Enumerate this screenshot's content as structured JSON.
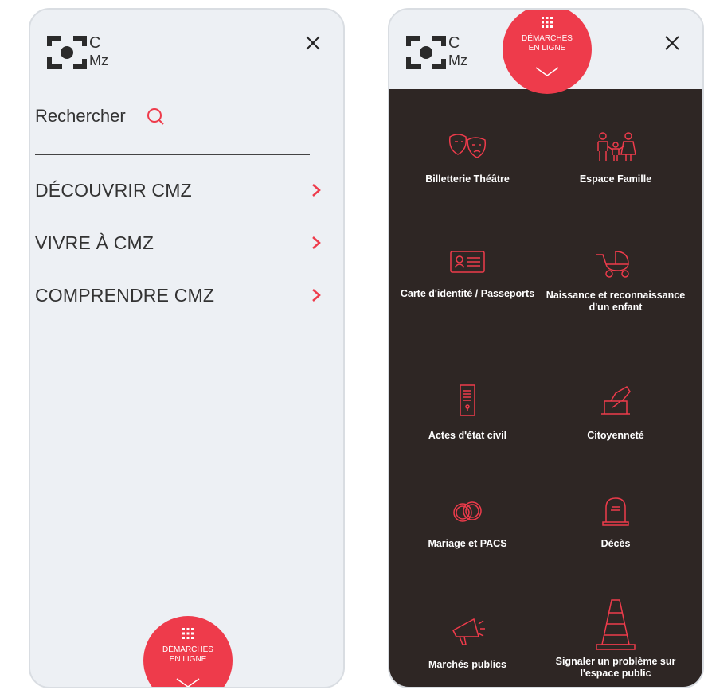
{
  "logo": {
    "letters": [
      "C",
      "Mz"
    ]
  },
  "left_panel": {
    "search_label": "Rechercher",
    "menu": [
      {
        "label": "DÉCOUVRIR CMZ"
      },
      {
        "label": "VIVRE À CMZ"
      },
      {
        "label": "COMPRENDRE CMZ"
      }
    ],
    "demarches_label": "DÉMARCHES EN LIGNE"
  },
  "right_panel": {
    "demarches_label": "DÉMARCHES EN LIGNE",
    "tiles": [
      {
        "label": "Billetterie Théâtre",
        "icon": "theatre-masks-icon"
      },
      {
        "label": "Espace Famille",
        "icon": "family-icon"
      },
      {
        "label": "Carte d'identité / Passeports",
        "icon": "id-card-icon"
      },
      {
        "label": "Naissance et reconnaissance d'un enfant",
        "icon": "baby-stroller-icon"
      },
      {
        "label": "Actes d'état civil",
        "icon": "document-icon"
      },
      {
        "label": "Citoyenneté",
        "icon": "ballot-box-icon"
      },
      {
        "label": "Mariage et PACS",
        "icon": "rings-icon"
      },
      {
        "label": "Décès",
        "icon": "tombstone-icon"
      },
      {
        "label": "Marchés publics",
        "icon": "megaphone-icon"
      },
      {
        "label": "Signaler un problème sur l'espace public",
        "icon": "traffic-cone-icon"
      }
    ]
  },
  "colors": {
    "accent": "#ee3b4b",
    "dark_bg": "#2e2624",
    "light_bg": "#edf0f4",
    "text": "#333333"
  }
}
